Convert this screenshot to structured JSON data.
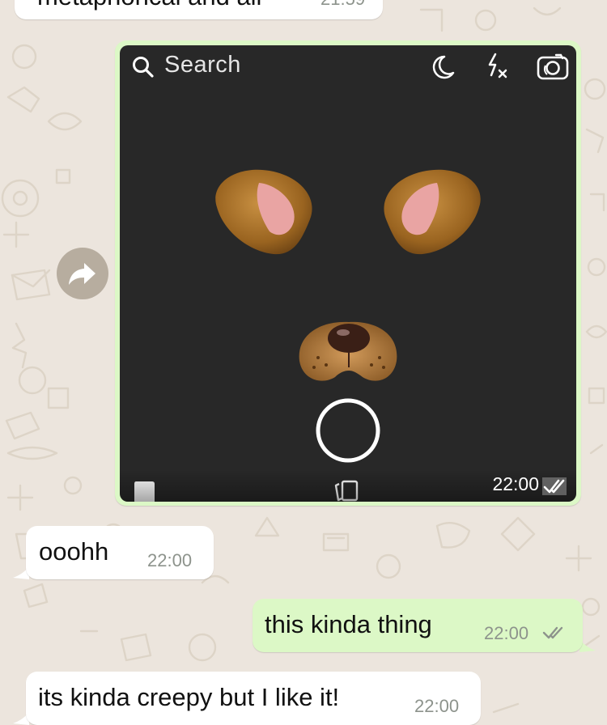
{
  "chat": {
    "prev_message": {
      "text": "metaphorical and all",
      "time": "21:59"
    },
    "image_message": {
      "time": "22:00",
      "status": "read",
      "snapchat_ui": {
        "search_placeholder": "Search",
        "icons": [
          "search-icon",
          "night-mode-icon",
          "flash-off-icon",
          "flip-camera-icon",
          "capture-button",
          "memories-icon",
          "chat-icon"
        ],
        "lens": "dog-ears-and-nose"
      }
    },
    "messages": [
      {
        "id": "m1",
        "direction": "incoming",
        "text": "ooohh",
        "time": "22:00"
      },
      {
        "id": "m2",
        "direction": "outgoing",
        "text": "this kinda thing",
        "time": "22:00",
        "status": "read"
      },
      {
        "id": "m3",
        "direction": "incoming",
        "text": "its kinda creepy but I like it!",
        "time": "22:00"
      }
    ]
  },
  "colors": {
    "wallpaper": "#ece5dd",
    "outgoing_bubble": "#dcf8c6",
    "incoming_bubble": "#ffffff",
    "tick_color": "#8d938c",
    "forward_button": "#b7ad9f"
  }
}
